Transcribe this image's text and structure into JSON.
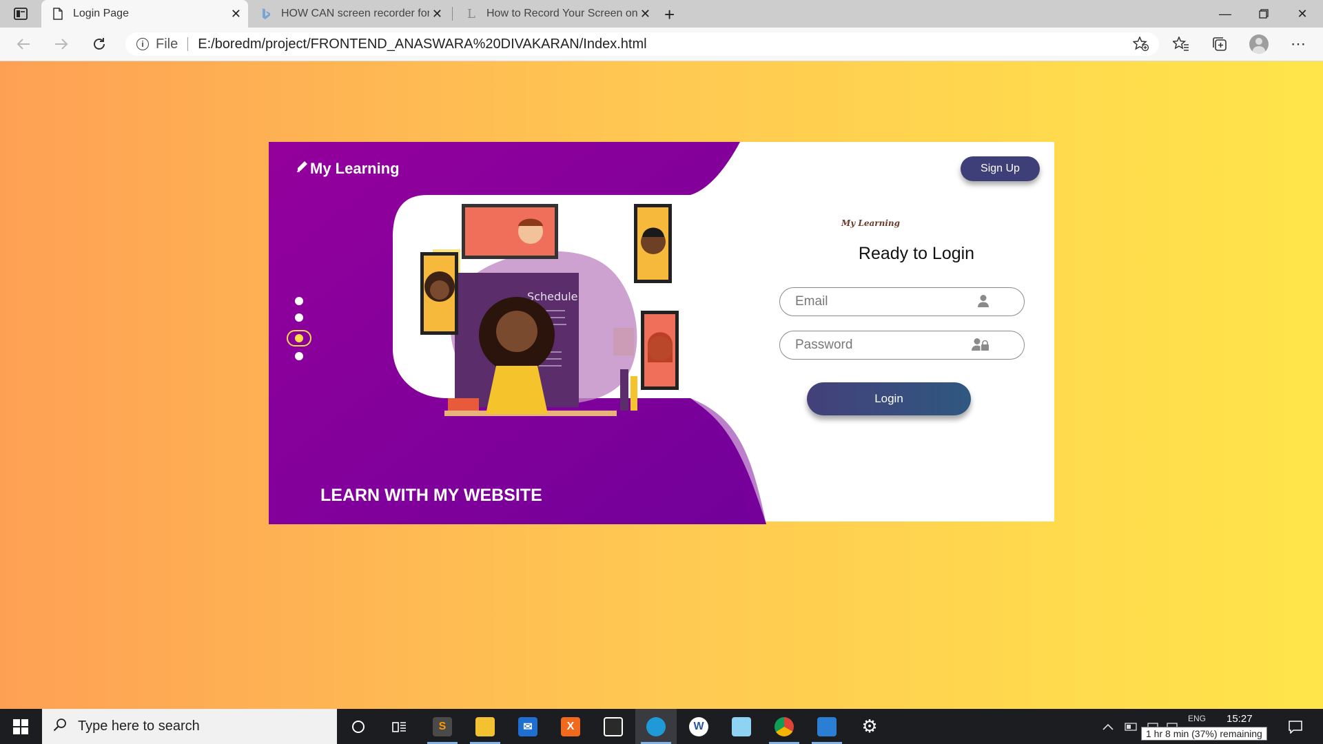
{
  "browser": {
    "tabs": [
      {
        "title": "Login Page",
        "active": true
      },
      {
        "title": "HOW CAN screen recorder for w",
        "active": false
      },
      {
        "title": "How to Record Your Screen on W",
        "active": false
      }
    ],
    "address": {
      "scheme_label": "File",
      "url": "E:/boredm/project/FRONTEND_ANASWARA%20DIVAKARAN/Index.html"
    }
  },
  "page": {
    "brand": "My Learning",
    "signup_label": "Sign Up",
    "mini_brand": "My Learning",
    "heading": "Ready to Login",
    "email_placeholder": "Email",
    "password_placeholder": "Password",
    "login_label": "Login",
    "tagline": "LEARN WITH MY WEBSITE",
    "illustration_text": "Schedule",
    "carousel": {
      "count": 4,
      "active_index": 2
    }
  },
  "taskbar": {
    "search_placeholder": "Type here to search",
    "clock": "15:27",
    "language": "ENG",
    "battery_tooltip": "1 hr 8 min (37%) remaining"
  },
  "colors": {
    "bg_start": "#fea054",
    "bg_end": "#ffe54a",
    "purple": "#94009c",
    "accent_yellow": "#ffdc4a",
    "button_blue": "#3e3f78"
  }
}
